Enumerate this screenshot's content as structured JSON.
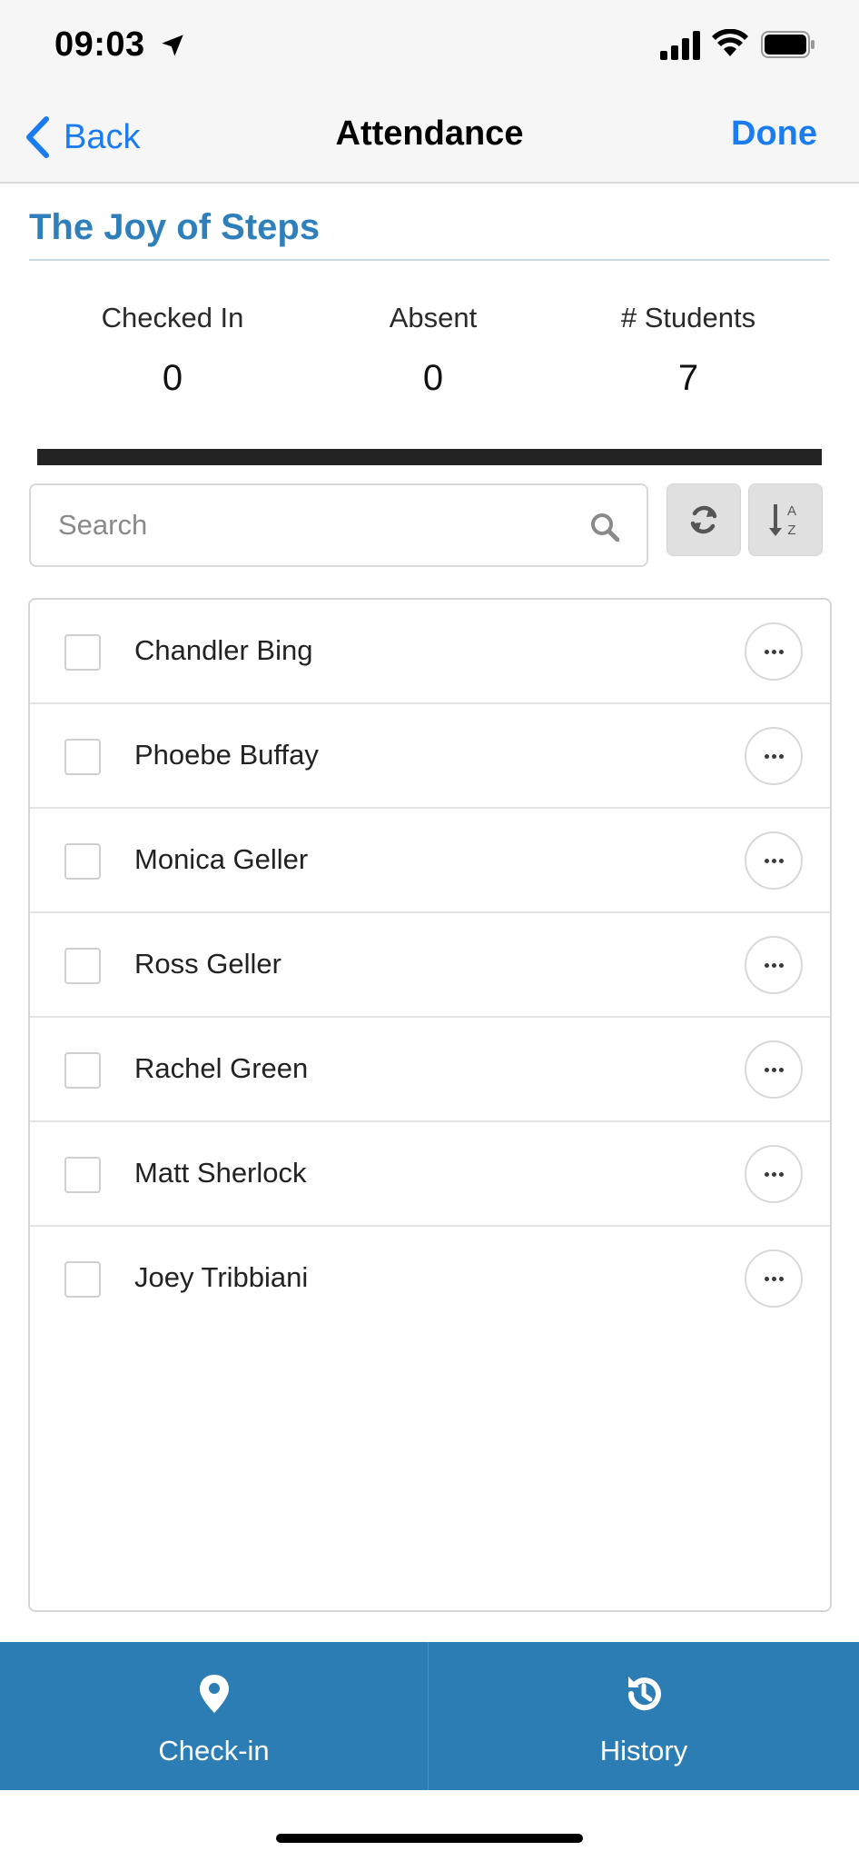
{
  "status_bar": {
    "time": "09:03"
  },
  "nav": {
    "back_label": "Back",
    "title": "Attendance",
    "done_label": "Done"
  },
  "class": {
    "title": "The Joy of Steps"
  },
  "stats": {
    "checked_in_label": "Checked In",
    "checked_in_value": "0",
    "absent_label": "Absent",
    "absent_value": "0",
    "students_label": "# Students",
    "students_value": "7"
  },
  "search": {
    "placeholder": "Search"
  },
  "students": [
    {
      "name": "Chandler Bing",
      "checked": false
    },
    {
      "name": "Phoebe Buffay",
      "checked": false
    },
    {
      "name": "Monica Geller",
      "checked": false
    },
    {
      "name": "Ross Geller",
      "checked": false
    },
    {
      "name": "Rachel Green",
      "checked": false
    },
    {
      "name": "Matt Sherlock",
      "checked": false
    },
    {
      "name": "Joey Tribbiani",
      "checked": false
    }
  ],
  "tabs": {
    "checkin_label": "Check-in",
    "history_label": "History"
  },
  "colors": {
    "accent": "#1a7cf0",
    "brand": "#2d7db5",
    "title": "#2f80ba"
  },
  "icons": [
    "location-arrow-icon",
    "signal-icon",
    "wifi-icon",
    "battery-icon",
    "chevron-left-icon",
    "search-icon",
    "refresh-icon",
    "sort-alpha-icon",
    "more-icon",
    "map-pin-icon",
    "history-icon"
  ]
}
